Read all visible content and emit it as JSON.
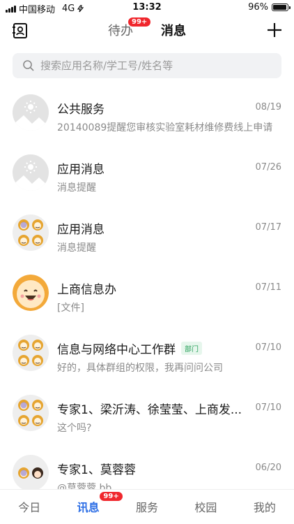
{
  "status_bar": {
    "carrier": "中国移动",
    "network": "4G",
    "time": "13:32",
    "battery": "96%",
    "battery_level": 0.96
  },
  "header": {
    "tabs": [
      {
        "label": "待办",
        "badge": "99+",
        "active": false
      },
      {
        "label": "消息",
        "active": true
      }
    ],
    "add_icon": "plus-icon",
    "contacts_icon": "contacts-icon"
  },
  "search": {
    "placeholder": "搜索应用名称/学工号/姓名等"
  },
  "conversations": [
    {
      "title": "公共服务",
      "time": "08/19",
      "preview": "20140089提醒您审核实验室耗材维修费线上申请",
      "avatar": "placeholder-icon"
    },
    {
      "title": "应用消息",
      "time": "07/26",
      "preview": "消息提醒",
      "avatar": "placeholder-icon"
    },
    {
      "title": "应用消息",
      "time": "07/17",
      "preview": "消息提醒",
      "avatar": "group-avatar"
    },
    {
      "title": "上商信息办",
      "time": "07/11",
      "preview": "[文件]",
      "avatar": "smiley-avatar"
    },
    {
      "title": "信息与网络中心工作群",
      "tag": "部门",
      "time": "07/10",
      "preview": "好的，具体群组的权限，我再问问公司",
      "avatar": "group-avatar"
    },
    {
      "title": "专家1、梁沂涛、徐莹莹、上商发...",
      "time": "07/10",
      "preview": "这个吗?",
      "avatar": "group-avatar"
    },
    {
      "title": "专家1、莫蓉蓉",
      "time": "06/20",
      "preview": "@莫蓉蓉 bb",
      "avatar": "group-avatar"
    }
  ],
  "tabbar": [
    {
      "label": "今日",
      "active": false
    },
    {
      "label": "讯息",
      "active": true,
      "badge": "99+"
    },
    {
      "label": "服务",
      "active": false
    },
    {
      "label": "校园",
      "active": false
    },
    {
      "label": "我的",
      "active": false
    }
  ],
  "colors": {
    "accent": "#2b6de5",
    "badge": "#f0272d",
    "search_bg": "#f1f2f4",
    "tag_green": "#2aa15b"
  }
}
